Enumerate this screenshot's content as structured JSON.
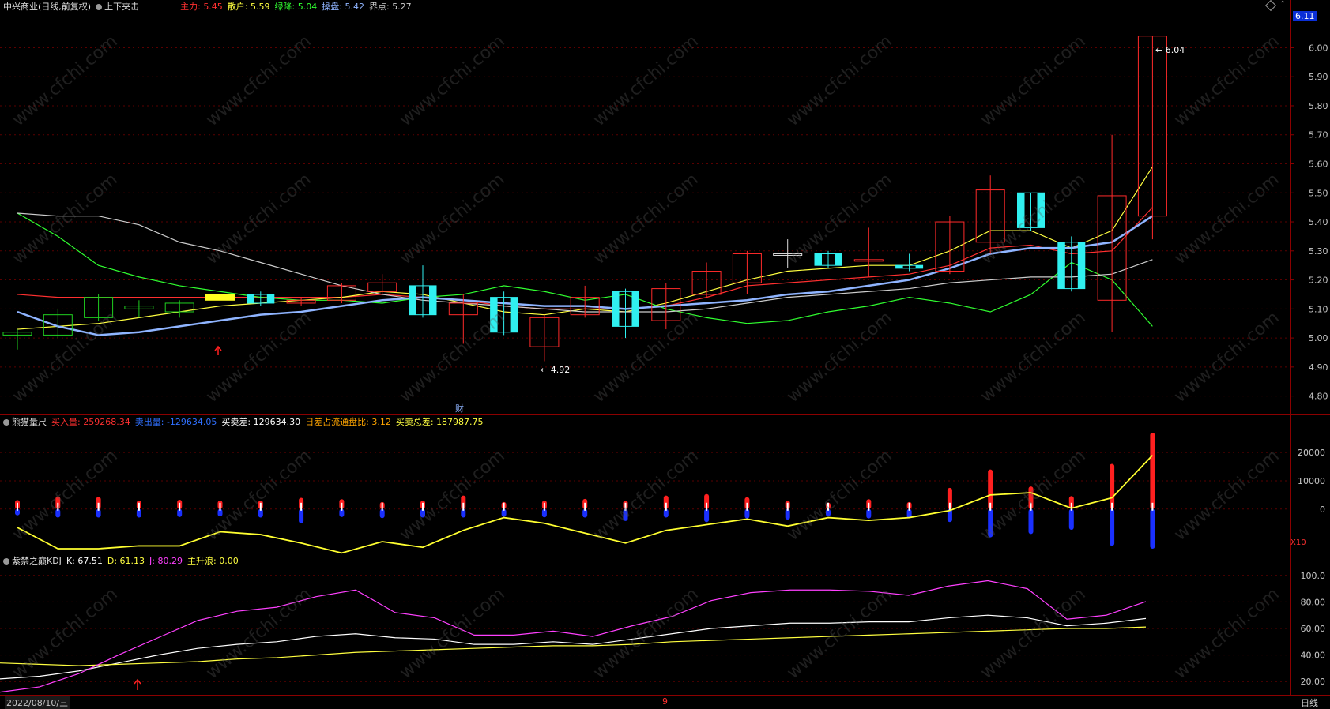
{
  "header": {
    "stock_title": "中兴商业(日线,前复权)",
    "indicator_name": "上下夹击",
    "items": [
      {
        "label": "主力:",
        "value": "5.45",
        "color": "#ff3030"
      },
      {
        "label": "散户:",
        "value": "5.59",
        "color": "#ffff40"
      },
      {
        "label": "绿降:",
        "value": "5.04",
        "color": "#30ff30"
      },
      {
        "label": "操盘:",
        "value": "5.42",
        "color": "#8fb4ff"
      },
      {
        "label": "界点:",
        "value": "5.27",
        "color": "#cccccc"
      }
    ],
    "price_tag": "6.11"
  },
  "panel2": {
    "name": "熊猫量尺",
    "items": [
      {
        "label": "买入量:",
        "value": "259268.34",
        "color": "#ff3030"
      },
      {
        "label": "卖出量:",
        "value": "-129634.05",
        "color": "#3070ff"
      },
      {
        "label": "买卖差:",
        "value": "129634.30",
        "color": "#ffffff"
      },
      {
        "label": "日差占流通盘比:",
        "value": "3.12",
        "color": "#ffa500"
      },
      {
        "label": "买卖总差:",
        "value": "187987.75",
        "color": "#ffff40"
      }
    ],
    "scale_label": "X10"
  },
  "panel3": {
    "name": "紫禁之巅KDJ",
    "items": [
      {
        "label": "K:",
        "value": "67.51",
        "color": "#ffffff"
      },
      {
        "label": "D:",
        "value": "61.13",
        "color": "#ffff40"
      },
      {
        "label": "J:",
        "value": "80.29",
        "color": "#ff40ff"
      },
      {
        "label": "主升浪:",
        "value": "0.00",
        "color": "#ffff40"
      }
    ]
  },
  "footer": {
    "date": "2022/08/10/三",
    "month_mark": "9",
    "period": "日线"
  },
  "annotations": {
    "high_label": "6.04",
    "low_label": "4.92",
    "event_mark": "财"
  },
  "watermark": "www.cfchi.com",
  "chart_data": [
    {
      "type": "candlestick",
      "ylim": [
        4.75,
        6.11
      ],
      "yticks": [
        "6.00",
        "5.90",
        "5.80",
        "5.70",
        "5.60",
        "5.50",
        "5.40",
        "5.30",
        "5.20",
        "5.10",
        "5.00",
        "4.90",
        "4.80"
      ],
      "candles": [
        {
          "o": 5.01,
          "c": 5.02,
          "h": 5.03,
          "l": 4.96,
          "color": "green",
          "hollow": true
        },
        {
          "o": 5.01,
          "c": 5.08,
          "h": 5.1,
          "l": 5.0,
          "color": "green",
          "hollow": true
        },
        {
          "o": 5.07,
          "c": 5.14,
          "h": 5.15,
          "l": 5.06,
          "color": "green",
          "hollow": true
        },
        {
          "o": 5.11,
          "c": 5.1,
          "h": 5.13,
          "l": 5.07,
          "color": "green",
          "hollow": true
        },
        {
          "o": 5.09,
          "c": 5.12,
          "h": 5.13,
          "l": 5.07,
          "color": "green",
          "hollow": true
        },
        {
          "o": 5.13,
          "c": 5.15,
          "h": 5.16,
          "l": 5.12,
          "color": "yellow",
          "hollow": false
        },
        {
          "o": 5.15,
          "c": 5.12,
          "h": 5.16,
          "l": 5.11,
          "color": "cyan",
          "hollow": false
        },
        {
          "o": 5.12,
          "c": 5.13,
          "h": 5.14,
          "l": 5.11,
          "color": "red",
          "hollow": true
        },
        {
          "o": 5.13,
          "c": 5.18,
          "h": 5.19,
          "l": 5.12,
          "color": "red",
          "hollow": true
        },
        {
          "o": 5.16,
          "c": 5.19,
          "h": 5.22,
          "l": 5.15,
          "color": "red",
          "hollow": true
        },
        {
          "o": 5.18,
          "c": 5.08,
          "h": 5.25,
          "l": 5.07,
          "color": "cyan",
          "hollow": false
        },
        {
          "o": 5.08,
          "c": 5.12,
          "h": 5.15,
          "l": 4.98,
          "color": "red",
          "hollow": true
        },
        {
          "o": 5.14,
          "c": 5.02,
          "h": 5.16,
          "l": 5.01,
          "color": "cyan",
          "hollow": false
        },
        {
          "o": 4.97,
          "c": 5.07,
          "h": 5.08,
          "l": 4.92,
          "color": "red",
          "hollow": true
        },
        {
          "o": 5.08,
          "c": 5.14,
          "h": 5.18,
          "l": 5.07,
          "color": "red",
          "hollow": true
        },
        {
          "o": 5.16,
          "c": 5.04,
          "h": 5.17,
          "l": 5.0,
          "color": "cyan",
          "hollow": false
        },
        {
          "o": 5.06,
          "c": 5.17,
          "h": 5.19,
          "l": 5.03,
          "color": "red",
          "hollow": true
        },
        {
          "o": 5.15,
          "c": 5.23,
          "h": 5.26,
          "l": 5.14,
          "color": "red",
          "hollow": true
        },
        {
          "o": 5.19,
          "c": 5.29,
          "h": 5.3,
          "l": 5.15,
          "color": "red",
          "hollow": true
        },
        {
          "o": 5.29,
          "c": 5.29,
          "h": 5.34,
          "l": 5.24,
          "color": "white",
          "hollow": true
        },
        {
          "o": 5.29,
          "c": 5.25,
          "h": 5.3,
          "l": 5.24,
          "color": "cyan",
          "hollow": false
        },
        {
          "o": 5.27,
          "c": 5.27,
          "h": 5.38,
          "l": 5.21,
          "color": "red",
          "hollow": true
        },
        {
          "o": 5.25,
          "c": 5.24,
          "h": 5.29,
          "l": 5.23,
          "color": "cyan",
          "hollow": false
        },
        {
          "o": 5.23,
          "c": 5.4,
          "h": 5.42,
          "l": 5.22,
          "color": "red",
          "hollow": true
        },
        {
          "o": 5.33,
          "c": 5.51,
          "h": 5.56,
          "l": 5.29,
          "color": "red",
          "hollow": true
        },
        {
          "o": 5.5,
          "c": 5.38,
          "h": 5.5,
          "l": 5.37,
          "color": "cyan",
          "hollow": false
        },
        {
          "o": 5.33,
          "c": 5.17,
          "h": 5.35,
          "l": 5.16,
          "color": "cyan",
          "hollow": false
        },
        {
          "o": 5.13,
          "c": 5.49,
          "h": 5.7,
          "l": 5.02,
          "color": "red",
          "hollow": true
        },
        {
          "o": 5.42,
          "c": 6.04,
          "h": 6.04,
          "l": 5.34,
          "color": "red",
          "hollow": true
        }
      ],
      "series": [
        {
          "name": "主力",
          "color": "#ff3030",
          "values": [
            5.15,
            5.14,
            5.14,
            5.14,
            5.14,
            5.14,
            5.14,
            5.14,
            5.14,
            5.15,
            5.14,
            5.13,
            5.11,
            5.1,
            5.1,
            5.1,
            5.11,
            5.14,
            5.18,
            5.19,
            5.2,
            5.21,
            5.22,
            5.25,
            5.31,
            5.32,
            5.29,
            5.3,
            5.45
          ]
        },
        {
          "name": "散户",
          "color": "#ffff40",
          "values": [
            5.03,
            5.04,
            5.05,
            5.07,
            5.09,
            5.11,
            5.12,
            5.13,
            5.14,
            5.16,
            5.15,
            5.12,
            5.09,
            5.08,
            5.1,
            5.09,
            5.12,
            5.16,
            5.2,
            5.23,
            5.24,
            5.25,
            5.25,
            5.3,
            5.37,
            5.37,
            5.31,
            5.37,
            5.59
          ]
        },
        {
          "name": "绿降",
          "color": "#30ff30",
          "values": [
            5.43,
            5.35,
            5.25,
            5.21,
            5.18,
            5.16,
            5.14,
            5.13,
            5.13,
            5.12,
            5.14,
            5.15,
            5.18,
            5.16,
            5.13,
            5.15,
            5.1,
            5.07,
            5.05,
            5.06,
            5.09,
            5.11,
            5.14,
            5.12,
            5.09,
            5.15,
            5.26,
            5.2,
            5.04
          ]
        },
        {
          "name": "操盘",
          "color": "#8fb4ff",
          "values": [
            5.09,
            5.04,
            5.01,
            5.02,
            5.04,
            5.06,
            5.08,
            5.09,
            5.11,
            5.13,
            5.14,
            5.13,
            5.12,
            5.11,
            5.11,
            5.1,
            5.11,
            5.12,
            5.13,
            5.15,
            5.16,
            5.18,
            5.2,
            5.24,
            5.29,
            5.31,
            5.31,
            5.33,
            5.42
          ]
        },
        {
          "name": "界点",
          "color": "#cccccc",
          "values": [
            5.43,
            5.42,
            5.42,
            5.39,
            5.33,
            5.3,
            5.26,
            5.22,
            5.18,
            5.15,
            5.13,
            5.12,
            5.11,
            5.1,
            5.09,
            5.09,
            5.09,
            5.1,
            5.12,
            5.14,
            5.15,
            5.16,
            5.17,
            5.19,
            5.2,
            5.21,
            5.21,
            5.22,
            5.27
          ]
        }
      ]
    },
    {
      "type": "bar",
      "ylim": [
        -14000,
        27000
      ],
      "yticks": [
        "20000",
        "10000",
        "0"
      ],
      "buy": [
        3200,
        4500,
        4300,
        3000,
        3300,
        3000,
        3000,
        4000,
        3500,
        2500,
        3000,
        4800,
        2500,
        3000,
        3600,
        3000,
        4800,
        5300,
        4200,
        3000,
        2300,
        3500,
        2500,
        7500,
        14000,
        8000,
        4600,
        16000,
        27000
      ],
      "sell": [
        -2200,
        -3000,
        -3000,
        -3000,
        -2800,
        -2600,
        -3000,
        -5000,
        -2800,
        -3200,
        -3000,
        -3000,
        -2700,
        -2900,
        -3000,
        -4200,
        -3000,
        -4600,
        -3300,
        -3700,
        -2600,
        -3300,
        -3200,
        -4600,
        -10000,
        -8800,
        -7300,
        -13000,
        -14000
      ],
      "line": [
        -6500,
        -14000,
        -14000,
        -13000,
        -13000,
        -8000,
        -9000,
        -12000,
        -15500,
        -11500,
        -13500,
        -7500,
        -3000,
        -5000,
        -8500,
        -12000,
        -7500,
        -5500,
        -3500,
        -6000,
        -3000,
        -4000,
        -3000,
        -500,
        5000,
        5800,
        300,
        4000,
        19000
      ]
    },
    {
      "type": "line",
      "ylim": [
        10,
        110
      ],
      "yticks": [
        "100.0",
        "80.00",
        "60.00",
        "40.00",
        "20.00"
      ],
      "series": [
        {
          "name": "K",
          "color": "#ffffff",
          "values": [
            22,
            24,
            28,
            34,
            40,
            45,
            48,
            50,
            54,
            56,
            53,
            52,
            48,
            48,
            50,
            48,
            52,
            56,
            60,
            62,
            64,
            64,
            65,
            65,
            68,
            70,
            68,
            62,
            64,
            67.51
          ]
        },
        {
          "name": "D",
          "color": "#ffff40",
          "values": [
            34,
            33,
            32,
            33,
            34,
            35,
            37,
            38,
            40,
            42,
            43,
            44,
            45,
            46,
            47,
            47,
            48,
            50,
            51,
            52,
            53,
            54,
            55,
            56,
            57,
            58,
            59,
            60,
            60,
            61.13
          ]
        },
        {
          "name": "J",
          "color": "#ff40ff",
          "values": [
            12,
            16,
            26,
            40,
            53,
            66,
            73,
            76,
            84,
            89,
            72,
            68,
            55,
            55,
            58,
            54,
            62,
            69,
            81,
            87,
            89,
            89,
            88,
            85,
            92,
            96,
            90,
            67,
            70,
            80.29
          ]
        }
      ]
    }
  ]
}
